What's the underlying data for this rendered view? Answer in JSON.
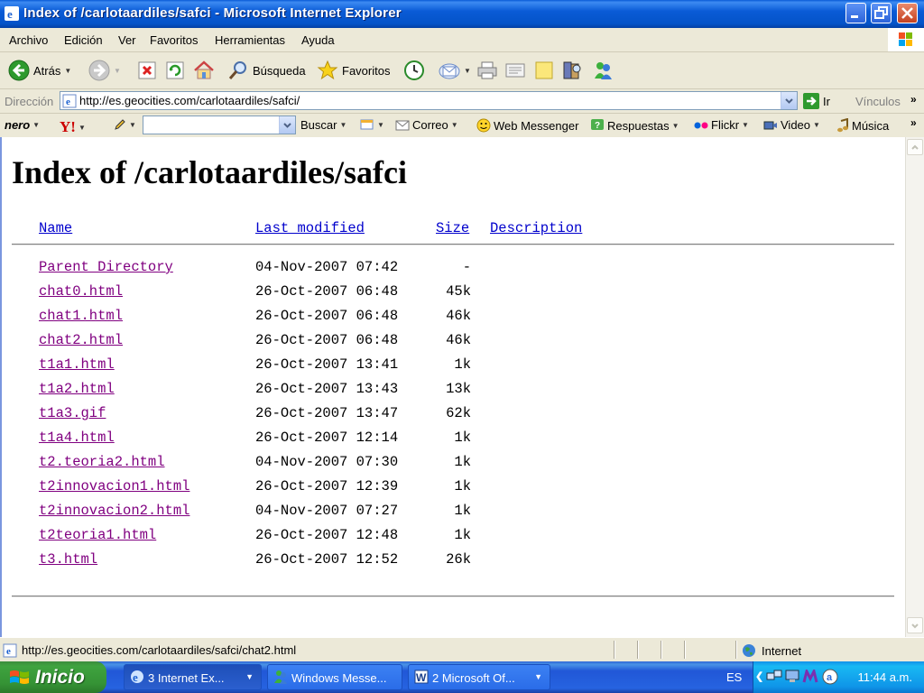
{
  "window": {
    "title": "Index of /carlotaardiles/safci - Microsoft Internet Explorer"
  },
  "menu": [
    "Archivo",
    "Edición",
    "Ver",
    "Favoritos",
    "Herramientas",
    "Ayuda"
  ],
  "toolbar": {
    "back_label": "Atrás",
    "search_label": "Búsqueda",
    "favorites_label": "Favoritos"
  },
  "address": {
    "label": "Dirección",
    "url": "http://es.geocities.com/carlotaardiles/safci/",
    "go_label": "Ir",
    "links_label": "Vínculos"
  },
  "linkbar": {
    "nero": "nero",
    "search_button": "Buscar",
    "mail": "Correo",
    "messenger": "Web Messenger",
    "answers": "Respuestas",
    "flickr": "Flickr",
    "video": "Video",
    "music": "Música"
  },
  "page": {
    "heading": "Index of /carlotaardiles/safci",
    "columns": {
      "name": "Name",
      "modified": "Last modified",
      "size": "Size",
      "description": "Description"
    },
    "files": [
      {
        "name": "Parent Directory",
        "modified": "04-Nov-2007 07:42",
        "size": "-"
      },
      {
        "name": "chat0.html",
        "modified": "26-Oct-2007 06:48",
        "size": "45k"
      },
      {
        "name": "chat1.html",
        "modified": "26-Oct-2007 06:48",
        "size": "46k"
      },
      {
        "name": "chat2.html",
        "modified": "26-Oct-2007 06:48",
        "size": "46k"
      },
      {
        "name": "t1a1.html",
        "modified": "26-Oct-2007 13:41",
        "size": "1k"
      },
      {
        "name": "t1a2.html",
        "modified": "26-Oct-2007 13:43",
        "size": "13k"
      },
      {
        "name": "t1a3.gif",
        "modified": "26-Oct-2007 13:47",
        "size": "62k"
      },
      {
        "name": "t1a4.html",
        "modified": "26-Oct-2007 12:14",
        "size": "1k"
      },
      {
        "name": "t2.teoria2.html",
        "modified": "04-Nov-2007 07:30",
        "size": "1k"
      },
      {
        "name": "t2innovacion1.html",
        "modified": "26-Oct-2007 12:39",
        "size": "1k"
      },
      {
        "name": "t2innovacion2.html",
        "modified": "04-Nov-2007 07:27",
        "size": "1k"
      },
      {
        "name": "t2teoria1.html",
        "modified": "26-Oct-2007 12:48",
        "size": "1k"
      },
      {
        "name": "t3.html",
        "modified": "26-Oct-2007 12:52",
        "size": "26k"
      }
    ]
  },
  "status": {
    "text": "http://es.geocities.com/carlotaardiles/safci/chat2.html",
    "zone": "Internet"
  },
  "taskbar": {
    "start": "Inicio",
    "tasks": [
      {
        "label": "3 Internet Ex..."
      },
      {
        "label": "Windows Messe..."
      },
      {
        "label": "2 Microsoft Of..."
      }
    ],
    "language": "ES",
    "clock": "11:44 a.m."
  }
}
